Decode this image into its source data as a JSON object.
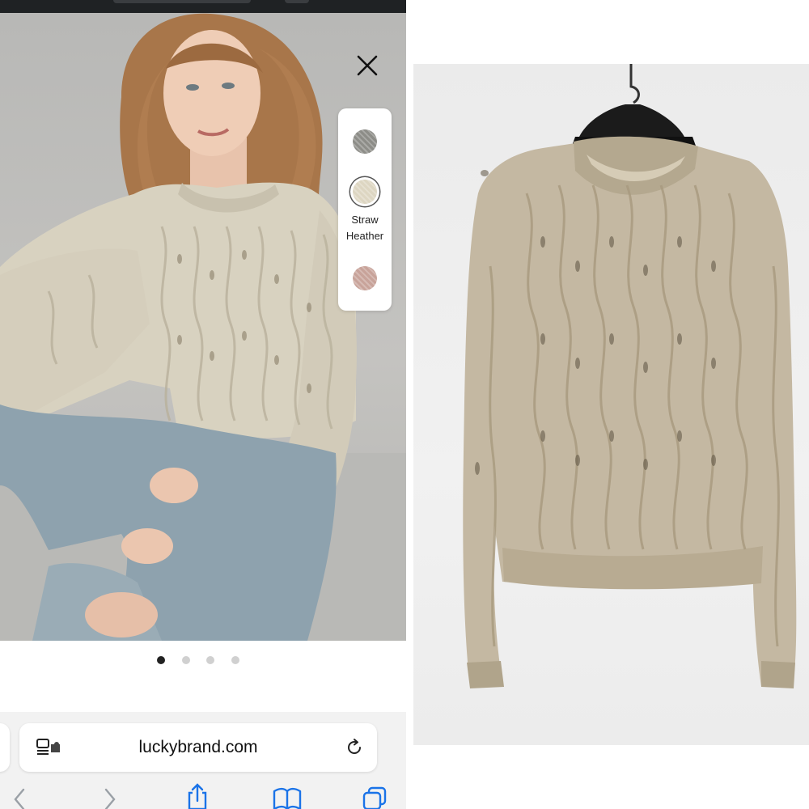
{
  "product_view": {
    "colors": [
      {
        "name": "",
        "swatch": "#8d8d88",
        "selected": false
      },
      {
        "name": "Straw Heather",
        "name_line1": "Straw",
        "name_line2": "Heather",
        "swatch": "#ddd6c2",
        "selected": true
      },
      {
        "name": "",
        "swatch": "#c8a39a",
        "selected": false
      }
    ],
    "carousel": {
      "total": 4,
      "current": 1
    }
  },
  "browser": {
    "url": "luckybrand.com",
    "icons": {
      "page_menu": "page-menu-icon",
      "reload": "reload-icon",
      "back": "chevron-left-icon",
      "forward": "chevron-right-icon",
      "share": "share-icon",
      "bookmarks": "book-icon",
      "tabs": "tabs-icon"
    }
  },
  "colors": {
    "accent_blue": "#1a73e8",
    "sweater": "#d8d2c0",
    "sweater_right": "#c4b8a2",
    "denim": "#8ea2ae"
  }
}
